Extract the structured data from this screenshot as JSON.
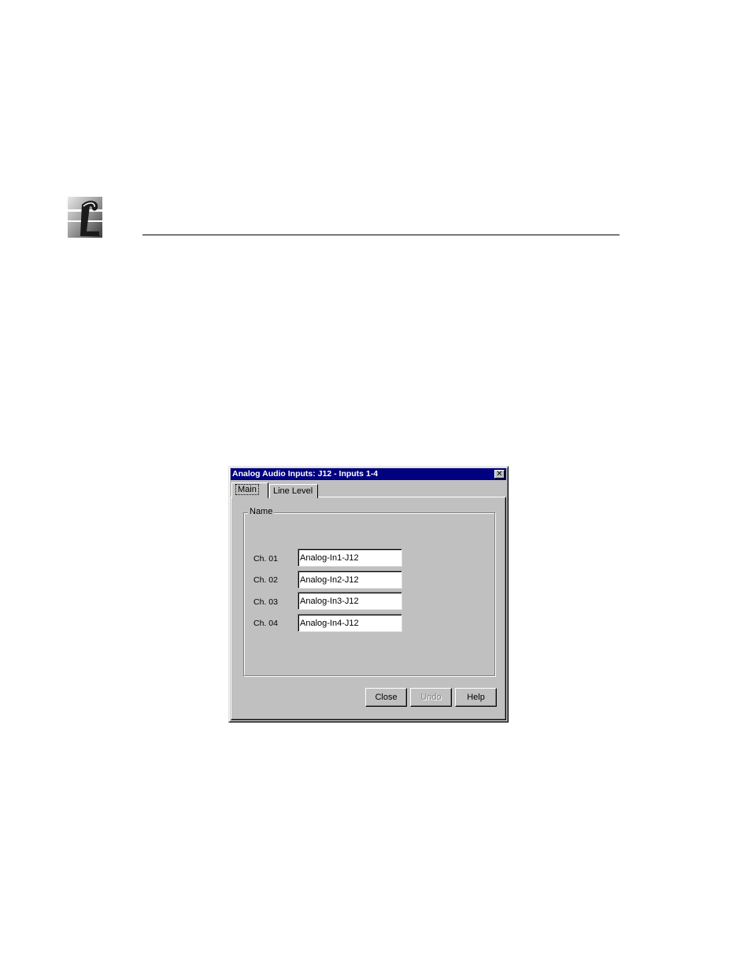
{
  "dialog": {
    "title": "Analog Audio Inputs: J12 - Inputs 1-4",
    "close_glyph": "✕",
    "tabs": [
      {
        "label": "Main"
      },
      {
        "label": "Line Level"
      }
    ],
    "group_label": "Name",
    "channels": [
      {
        "label": "Ch. 01",
        "value": "Analog-In1-J12"
      },
      {
        "label": "Ch. 02",
        "value": "Analog-In2-J12"
      },
      {
        "label": "Ch. 03",
        "value": "Analog-In3-J12"
      },
      {
        "label": "Ch. 04",
        "value": "Analog-In4-J12"
      }
    ],
    "buttons": {
      "close": "Close",
      "undo": "Undo",
      "help": "Help"
    }
  },
  "colors": {
    "titlebar": "#000080",
    "face": "#c0c0c0"
  },
  "icons": {
    "logo": "company-logo-icon",
    "close": "close-icon"
  }
}
